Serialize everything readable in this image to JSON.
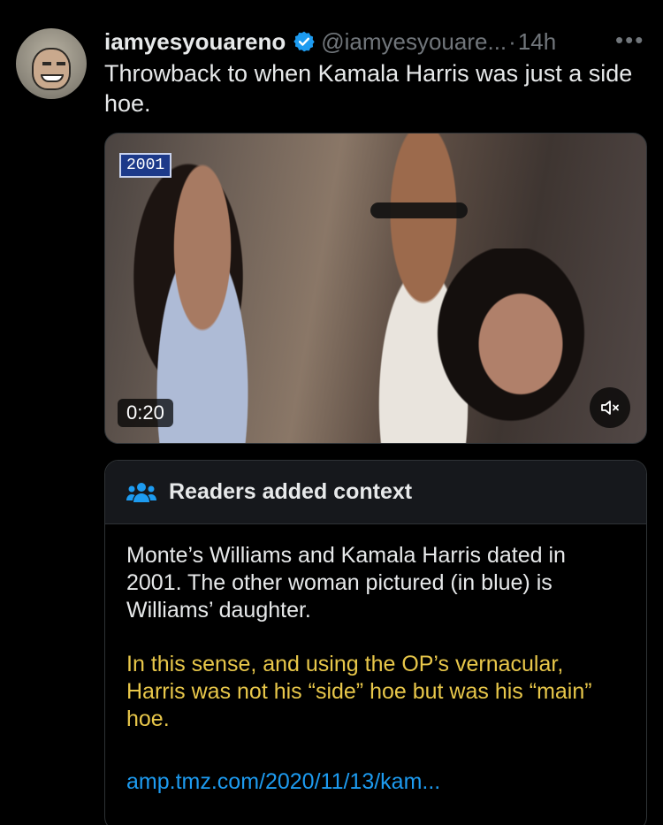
{
  "post": {
    "display_name": "iamyesyouareno",
    "handle": "@iamyesyouare...",
    "separator": "·",
    "time": "14h",
    "more": "•••",
    "text": "Throwback to when Kamala Harris was just a side hoe."
  },
  "video": {
    "year_badge": "2001",
    "duration": "0:20"
  },
  "community_note": {
    "title": "Readers added context",
    "paragraph_1": "Monte’s Williams and Kamala Harris dated in 2001. The other woman pictured (in blue) is Williams’ daughter.",
    "paragraph_2": "In this sense, and using the OP’s vernacular, Harris was not his “side” hoe but was his “main” hoe.",
    "link": "amp.tmz.com/2020/11/13/kam..."
  },
  "colors": {
    "background": "#000000",
    "text": "#e7e9ea",
    "muted": "#71767b",
    "link": "#1d9bf0",
    "verified": "#1d9bf0",
    "highlight_text": "#e8c74a",
    "note_header": "#16181c",
    "border": "#2f3336"
  },
  "icons": {
    "verified": "verified-badge-icon",
    "mute": "speaker-muted-icon",
    "people": "people-group-icon",
    "more": "more-horizontal-icon"
  }
}
